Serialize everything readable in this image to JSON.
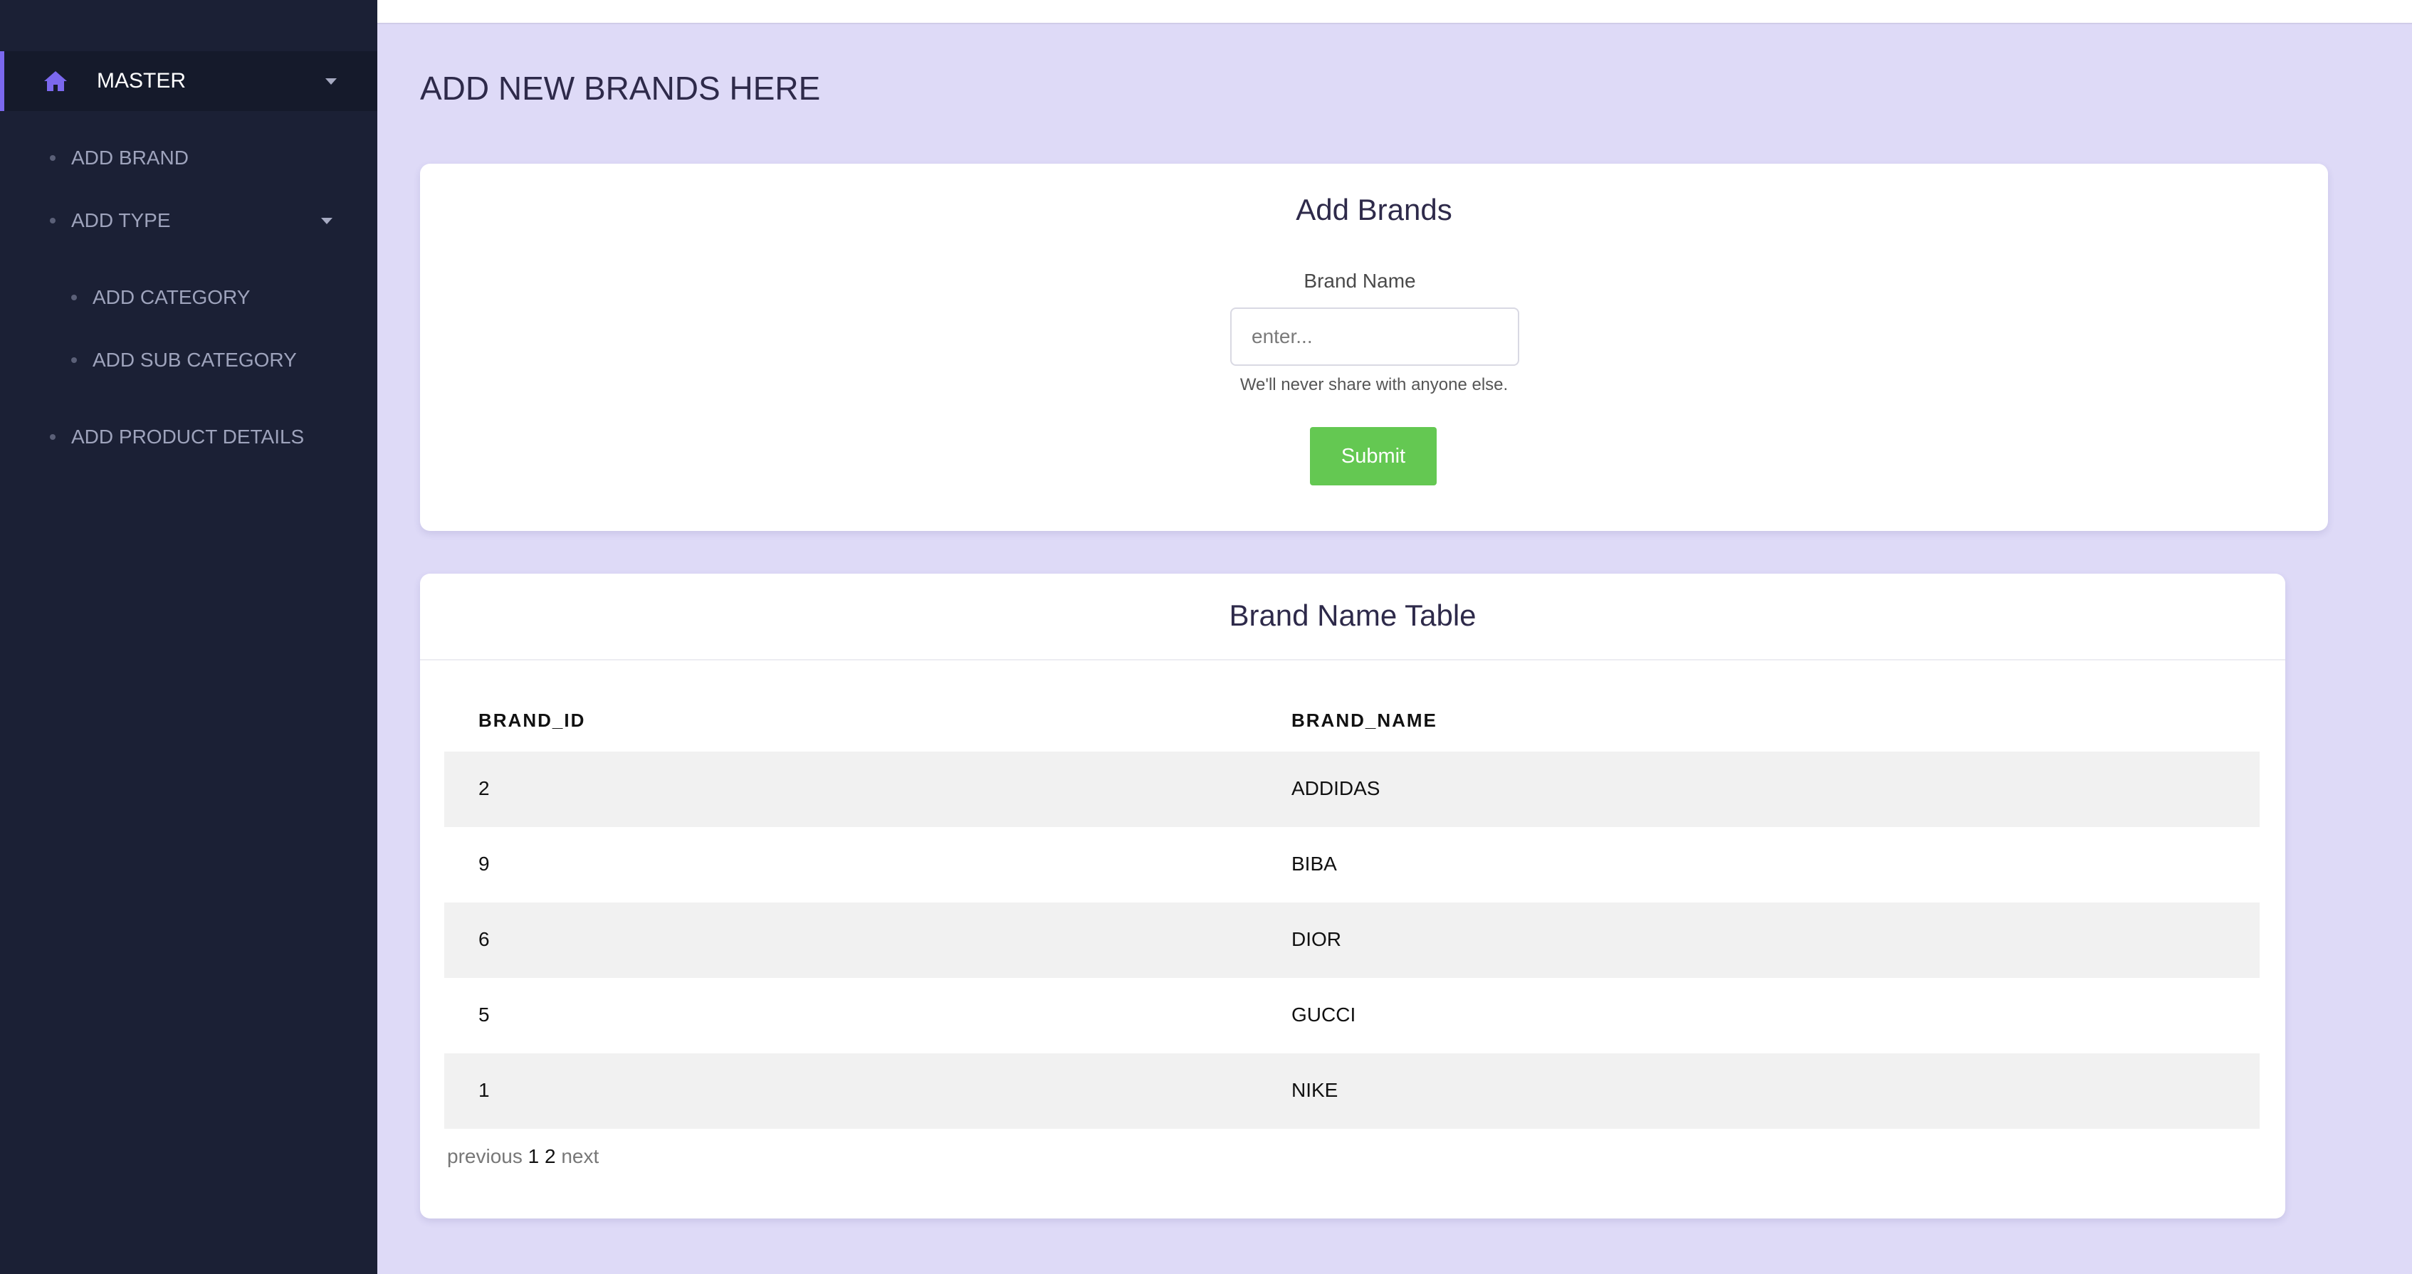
{
  "sidebar": {
    "master_label": "MASTER",
    "items": [
      {
        "label": "ADD BRAND"
      },
      {
        "label": "ADD TYPE"
      },
      {
        "label": "ADD CATEGORY"
      },
      {
        "label": "ADD SUB CATEGORY"
      },
      {
        "label": "ADD PRODUCT DETAILS"
      }
    ]
  },
  "page": {
    "title": "ADD NEW BRANDS HERE"
  },
  "form": {
    "title": "Add Brands",
    "field_label": "Brand Name",
    "placeholder": "enter...",
    "value": "",
    "help_text": "We'll never share with anyone else.",
    "submit_label": "Submit"
  },
  "table": {
    "title": "Brand Name Table",
    "headers": [
      "BRAND_ID",
      "BRAND_NAME"
    ],
    "rows": [
      {
        "id": "2",
        "name": "ADDIDAS"
      },
      {
        "id": "9",
        "name": "BIBA"
      },
      {
        "id": "6",
        "name": "DIOR"
      },
      {
        "id": "5",
        "name": "GUCCI"
      },
      {
        "id": "1",
        "name": "NIKE"
      }
    ]
  },
  "pagination": {
    "previous_label": "previous",
    "pages": [
      "1",
      "2"
    ],
    "next_label": "next"
  },
  "colors": {
    "sidebar_bg": "#1b2035",
    "page_bg": "#dedaf7",
    "accent": "#7b68ee",
    "submit_bg": "#64c852",
    "row_shade": "#f1f1f1"
  },
  "icons": {
    "master": "home-icon",
    "dropdown": "caret-down-icon"
  }
}
